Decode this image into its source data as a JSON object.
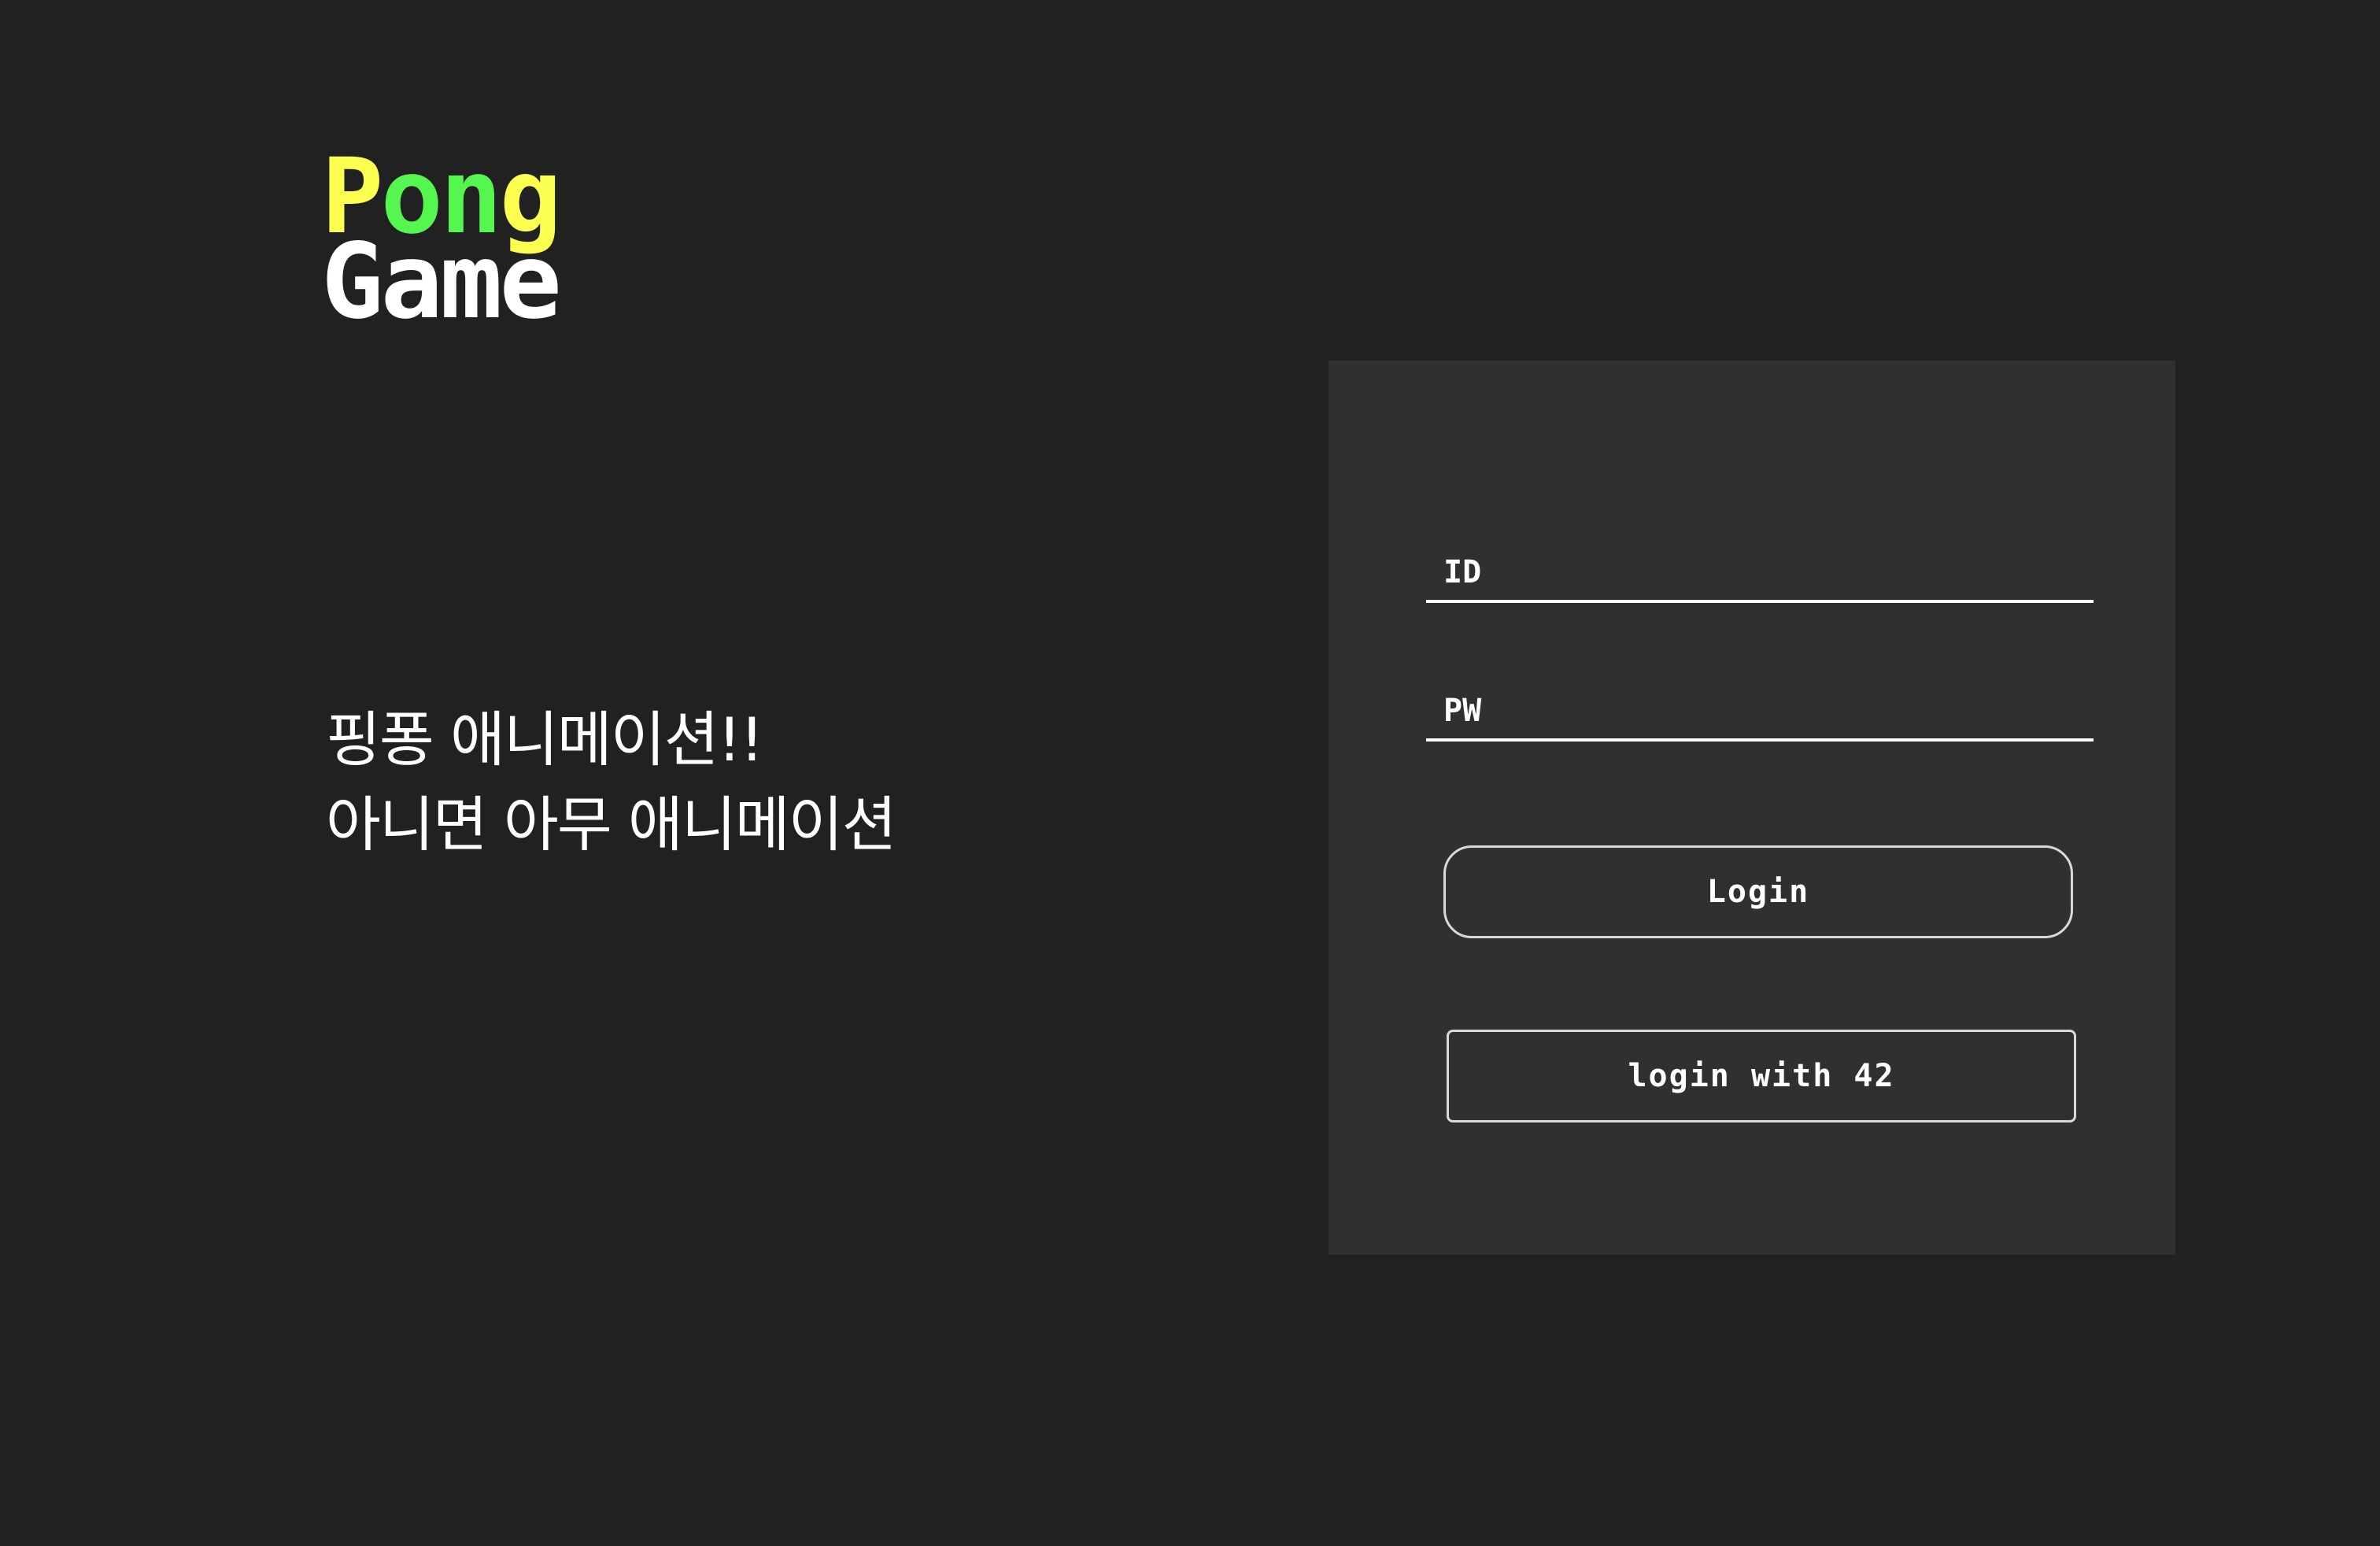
{
  "logo": {
    "line1": [
      {
        "char": "P",
        "color": "#fcff4f"
      },
      {
        "char": "o",
        "color": "#55f64f"
      },
      {
        "char": "n",
        "color": "#55f64f"
      },
      {
        "char": "g",
        "color": "#fcff4f"
      }
    ],
    "line2": [
      {
        "char": "G",
        "color": "#ffffff"
      },
      {
        "char": "a",
        "color": "#ffffff"
      },
      {
        "char": "m",
        "color": "#ffffff"
      },
      {
        "char": "e",
        "color": "#ffffff"
      }
    ]
  },
  "tagline": {
    "line1": "핑퐁 애니메이션!!",
    "line2": "아니면 아무 애니메이션"
  },
  "login_form": {
    "id_placeholder": "ID",
    "id_value": "",
    "pw_placeholder": "PW",
    "pw_value": "",
    "login_button": "Login",
    "login42_button": "login with 42"
  },
  "colors": {
    "background": "#212121",
    "panel": "#303030",
    "accent_yellow": "#fcff4f",
    "accent_green": "#55f64f",
    "text": "#ffffff"
  }
}
